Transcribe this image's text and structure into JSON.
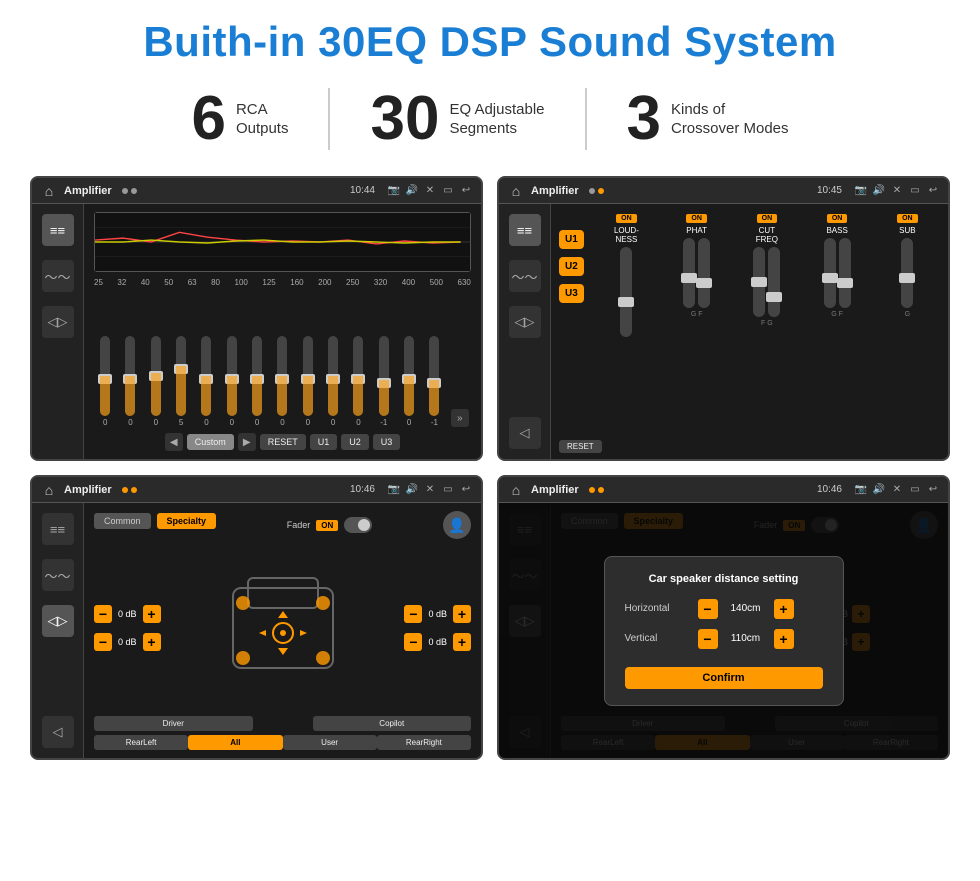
{
  "page": {
    "title": "Buith-in 30EQ DSP Sound System",
    "stats": [
      {
        "number": "6",
        "label": "RCA\nOutputs"
      },
      {
        "number": "30",
        "label": "EQ Adjustable\nSegments"
      },
      {
        "number": "3",
        "label": "Kinds of\nCrossover Modes"
      }
    ]
  },
  "screen1": {
    "app_name": "Amplifier",
    "time": "10:44",
    "eq_bands": [
      "25",
      "32",
      "40",
      "50",
      "63",
      "80",
      "100",
      "125",
      "160",
      "200",
      "250",
      "320",
      "400",
      "500",
      "630"
    ],
    "eq_values": [
      "0",
      "0",
      "0",
      "5",
      "0",
      "0",
      "0",
      "0",
      "0",
      "0",
      "0",
      "-1",
      "0",
      "-1",
      ""
    ],
    "controls": [
      "Custom",
      "RESET",
      "U1",
      "U2",
      "U3"
    ],
    "mode": "Custom"
  },
  "screen2": {
    "app_name": "Amplifier",
    "time": "10:45",
    "presets": [
      "U1",
      "U2",
      "U3"
    ],
    "channels": [
      "LOUDNESS",
      "PHAT",
      "CUT FREQ",
      "BASS",
      "SUB"
    ],
    "toggles": [
      "ON",
      "ON",
      "ON",
      "ON",
      "ON"
    ],
    "reset_label": "RESET"
  },
  "screen3": {
    "app_name": "Amplifier",
    "time": "10:46",
    "tabs": [
      "Common",
      "Specialty"
    ],
    "fader_label": "Fader",
    "fader_toggle": "ON",
    "db_values": [
      "0 dB",
      "0 dB",
      "0 dB",
      "0 dB"
    ],
    "bottom_buttons": [
      "Driver",
      "All",
      "User",
      "Copilot",
      "RearLeft",
      "RearRight"
    ]
  },
  "screen4": {
    "app_name": "Amplifier",
    "time": "10:46",
    "tabs": [
      "Common",
      "Specialty"
    ],
    "dialog": {
      "title": "Car speaker distance setting",
      "rows": [
        {
          "label": "Horizontal",
          "value": "140cm"
        },
        {
          "label": "Vertical",
          "value": "110cm"
        }
      ],
      "confirm_label": "Confirm"
    },
    "db_values": [
      "0 dB",
      "0 dB"
    ],
    "bottom_buttons": [
      "Driver",
      "All",
      "User",
      "Copilot",
      "RearLeft",
      "RearRight"
    ]
  }
}
